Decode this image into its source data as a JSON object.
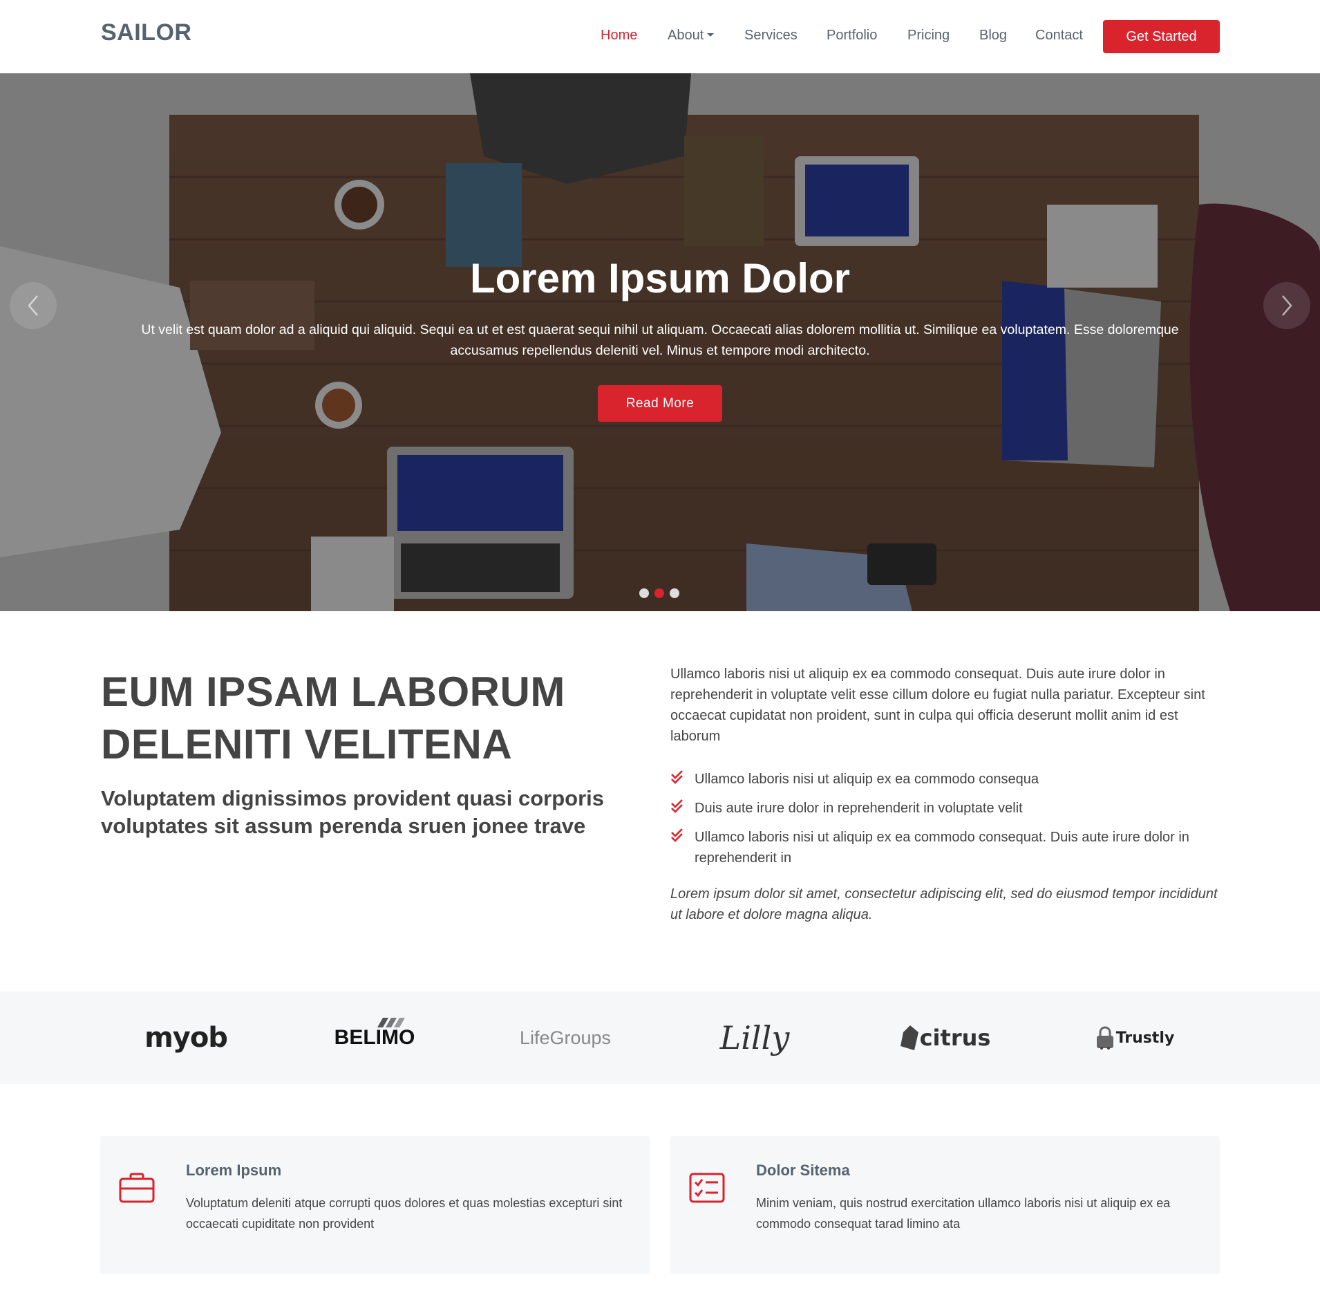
{
  "header": {
    "logo": "SAILOR",
    "nav": [
      {
        "label": "Home",
        "active": true
      },
      {
        "label": "About",
        "dropdown": true
      },
      {
        "label": "Services"
      },
      {
        "label": "Portfolio"
      },
      {
        "label": "Pricing"
      },
      {
        "label": "Blog"
      },
      {
        "label": "Contact"
      }
    ],
    "cta_label": "Get Started"
  },
  "hero": {
    "title": "Lorem Ipsum Dolor",
    "text": "Ut velit est quam dolor ad a aliquid qui aliquid. Sequi ea ut et est quaerat sequi nihil ut aliquam. Occaecati alias dolorem mollitia ut. Similique ea voluptatem. Esse doloremque accusamus repellendus deleniti vel. Minus et tempore modi architecto.",
    "button_label": "Read More",
    "slide_count": 3,
    "active_slide": 2
  },
  "about": {
    "title": "EUM IPSAM LABORUM DELENITI VELITENA",
    "subtitle": "Voluptatem dignissimos provident quasi corporis voluptates sit assum perenda sruen jonee trave",
    "paragraph": "Ullamco laboris nisi ut aliquip ex ea commodo consequat. Duis aute irure dolor in reprehenderit in voluptate velit esse cillum dolore eu fugiat nulla pariatur. Excepteur sint occaecat cupidatat non proident, sunt in culpa qui officia deserunt mollit anim id est laborum",
    "list": [
      "Ullamco laboris nisi ut aliquip ex ea commodo consequa",
      "Duis aute irure dolor in reprehenderit in voluptate velit",
      "Ullamco laboris nisi ut aliquip ex ea commodo consequat. Duis aute irure dolor in reprehenderit in"
    ],
    "italic": "Lorem ipsum dolor sit amet, consectetur adipiscing elit, sed do eiusmod tempor incididunt ut labore et dolore magna aliqua."
  },
  "clients": [
    "myob",
    "BELIMO",
    "LifeGroups",
    "Lilly",
    "citrus",
    "Trustly"
  ],
  "services": [
    {
      "icon": "briefcase-icon",
      "title": "Lorem Ipsum",
      "text": "Voluptatum deleniti atque corrupti quos dolores et quas molestias excepturi sint occaecati cupiditate non provident"
    },
    {
      "icon": "checklist-icon",
      "title": "Dolor Sitema",
      "text": "Minim veniam, quis nostrud exercitation ullamco laboris nisi ut aliquip ex ea commodo consequat tarad limino ata"
    }
  ],
  "colors": {
    "accent": "#d9232d",
    "heading": "#556270",
    "text": "#444444",
    "light_bg": "#f6f7f8"
  }
}
